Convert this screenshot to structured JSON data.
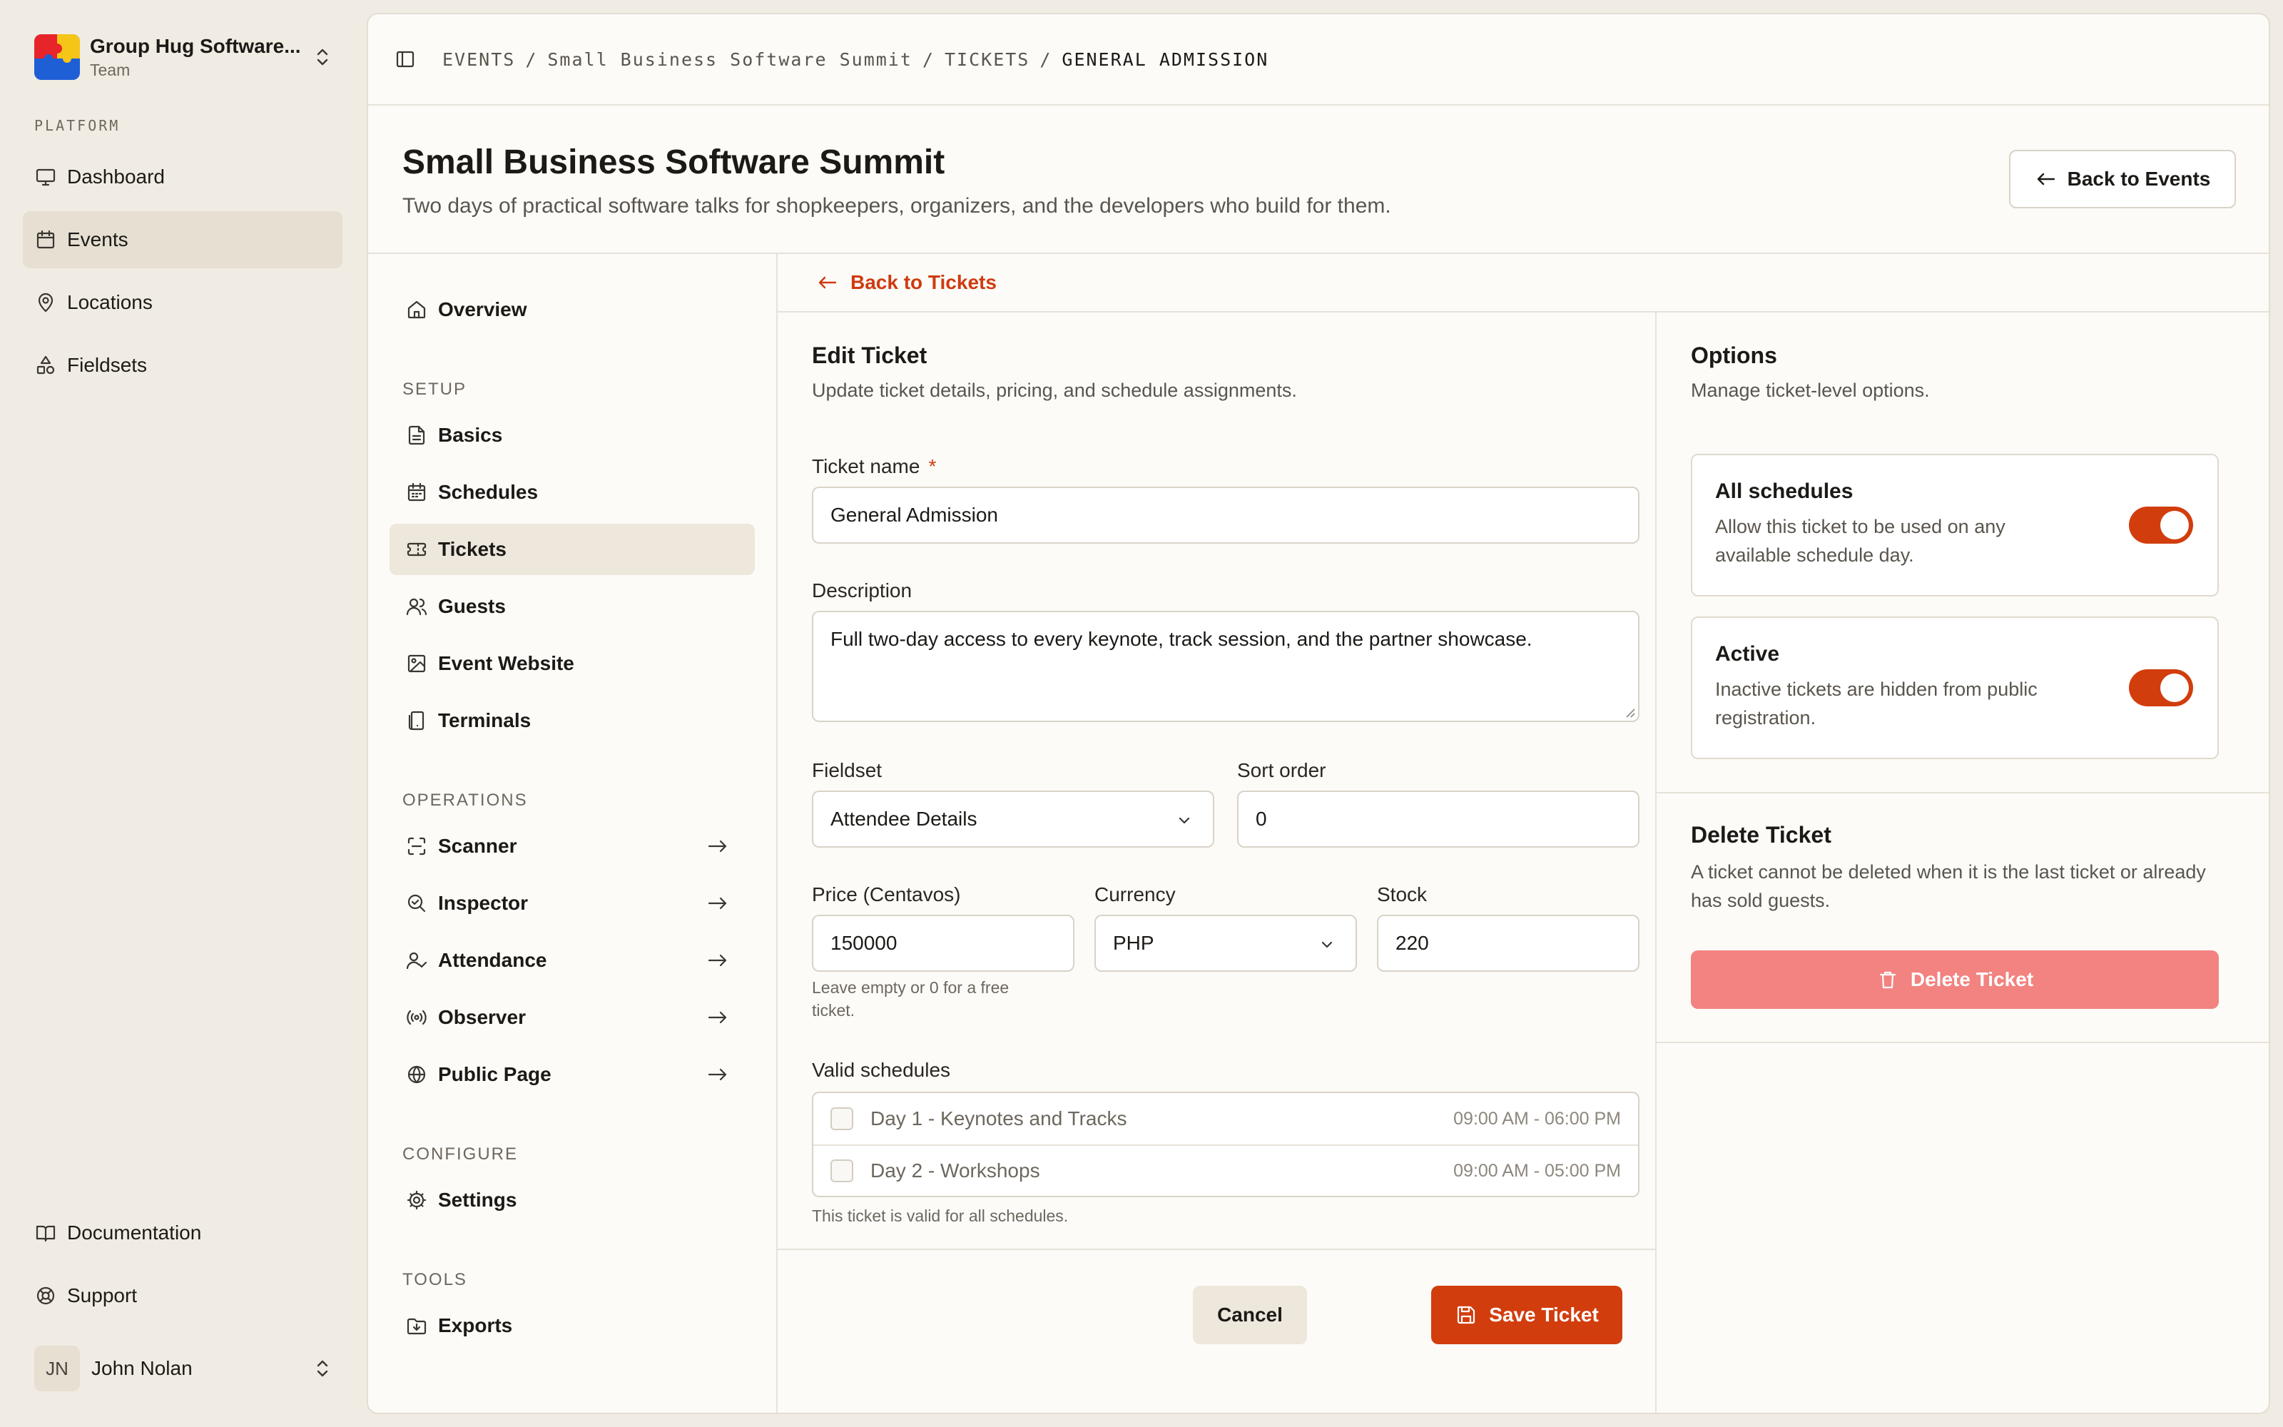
{
  "team": {
    "name": "Group Hug Software...",
    "subtitle": "Team"
  },
  "sidebar": {
    "section_label": "PLATFORM",
    "items": [
      {
        "label": "Dashboard",
        "icon": "monitor-icon"
      },
      {
        "label": "Events",
        "icon": "calendar-icon",
        "active": true
      },
      {
        "label": "Locations",
        "icon": "map-pin-icon"
      },
      {
        "label": "Fieldsets",
        "icon": "shapes-icon"
      }
    ],
    "bottom_items": [
      {
        "label": "Documentation",
        "icon": "book-icon"
      },
      {
        "label": "Support",
        "icon": "lifebuoy-icon"
      }
    ],
    "user": {
      "initials": "JN",
      "name": "John Nolan"
    }
  },
  "breadcrumb": [
    "EVENTS",
    "Small Business Software Summit",
    "TICKETS",
    "GENERAL ADMISSION"
  ],
  "page": {
    "title": "Small Business Software Summit",
    "subtitle": "Two days of practical software talks for shopkeepers, organizers, and the developers who build for them.",
    "back_button": "Back to Events"
  },
  "event_nav": {
    "overview": "Overview",
    "setup_label": "SETUP",
    "setup": [
      "Basics",
      "Schedules",
      "Tickets",
      "Guests",
      "Event Website",
      "Terminals"
    ],
    "operations_label": "OPERATIONS",
    "operations": [
      "Scanner",
      "Inspector",
      "Attendance",
      "Observer",
      "Public Page"
    ],
    "configure_label": "CONFIGURE",
    "configure": [
      "Settings"
    ],
    "tools_label": "TOOLS",
    "tools": [
      "Exports"
    ]
  },
  "back_to_tickets": "Back to Tickets",
  "form": {
    "title": "Edit Ticket",
    "subtitle": "Update ticket details, pricing, and schedule assignments.",
    "ticket_name_label": "Ticket name",
    "required_mark": "*",
    "ticket_name": "General Admission",
    "description_label": "Description",
    "description": "Full two-day access to every keynote, track session, and the partner showcase.",
    "fieldset_label": "Fieldset",
    "fieldset": "Attendee Details",
    "sort_label": "Sort order",
    "sort": "0",
    "price_label": "Price (Centavos)",
    "price": "150000",
    "price_hint": "Leave empty or 0 for a free ticket.",
    "currency_label": "Currency",
    "currency": "PHP",
    "stock_label": "Stock",
    "stock": "220",
    "schedules_label": "Valid schedules",
    "schedules": [
      {
        "name": "Day 1 - Keynotes and Tracks",
        "time": "09:00 AM - 06:00 PM"
      },
      {
        "name": "Day 2 - Workshops",
        "time": "09:00 AM - 05:00 PM"
      }
    ],
    "schedules_hint": "This ticket is valid for all schedules.",
    "cancel": "Cancel",
    "save": "Save Ticket"
  },
  "options": {
    "title": "Options",
    "subtitle": "Manage ticket-level options.",
    "all_schedules": {
      "title": "All schedules",
      "desc": "Allow this ticket to be used on any available schedule day.",
      "on": true
    },
    "active": {
      "title": "Active",
      "desc": "Inactive tickets are hidden from public registration.",
      "on": true
    }
  },
  "delete": {
    "title": "Delete Ticket",
    "desc": "A ticket cannot be deleted when it is the last ticket or already has sold guests.",
    "button": "Delete Ticket"
  },
  "colors": {
    "accent": "#d23d0e",
    "delete": "#f28380",
    "background": "#f1ece3"
  }
}
